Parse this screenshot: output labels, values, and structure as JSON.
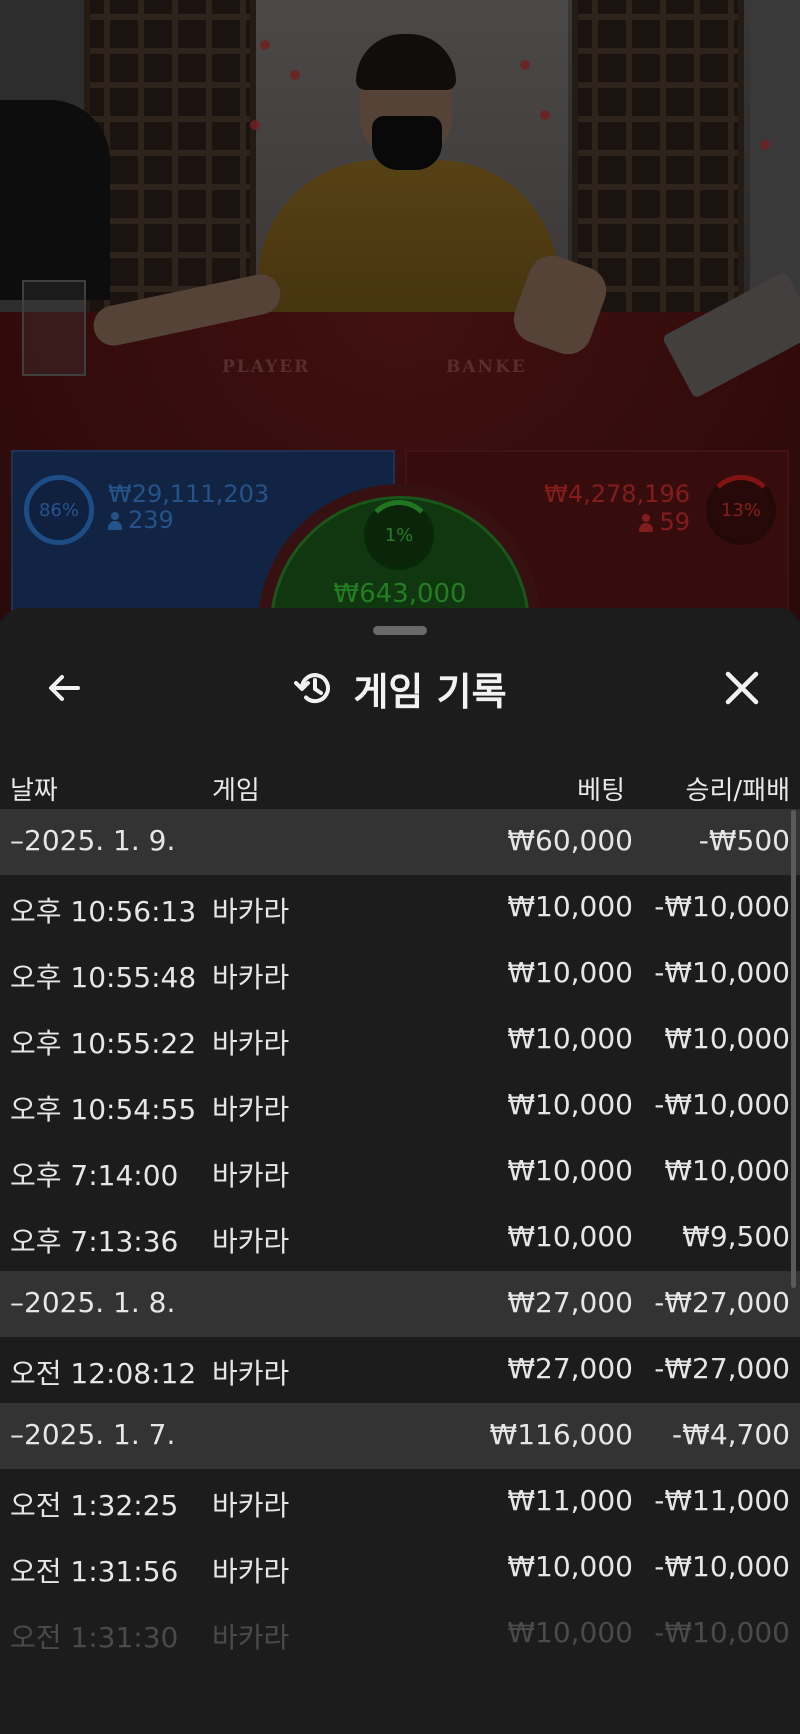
{
  "video": {
    "table_labels": {
      "player": "PLAYER",
      "banker": "BANKE"
    }
  },
  "board": {
    "player": {
      "percent": "86%",
      "amount": "₩29,111,203",
      "count": "239",
      "color": "#3c86dd"
    },
    "banker": {
      "percent": "13%",
      "amount": "₩4,278,196",
      "count": "59",
      "color": "#d43030"
    },
    "tie": {
      "percent": "1%",
      "amount": "₩643,000",
      "color": "#3ac83a"
    }
  },
  "sheet": {
    "title": "게임 기록",
    "icons": {
      "back": "arrow-left-icon",
      "history": "history-icon",
      "close": "close-icon"
    },
    "columns": {
      "date": "날짜",
      "game": "게임",
      "bet": "베팅",
      "win_loss": "승리/패배"
    },
    "groups": [
      {
        "date": "–2025. 1. 9.",
        "bet": "₩60,000",
        "win_loss": "-₩500",
        "rows": [
          {
            "time": "오후 10:56:13",
            "game": "바카라",
            "bet": "₩10,000",
            "win_loss": "-₩10,000"
          },
          {
            "time": "오후 10:55:48",
            "game": "바카라",
            "bet": "₩10,000",
            "win_loss": "-₩10,000"
          },
          {
            "time": "오후 10:55:22",
            "game": "바카라",
            "bet": "₩10,000",
            "win_loss": "₩10,000"
          },
          {
            "time": "오후 10:54:55",
            "game": "바카라",
            "bet": "₩10,000",
            "win_loss": "-₩10,000"
          },
          {
            "time": "오후 7:14:00",
            "game": "바카라",
            "bet": "₩10,000",
            "win_loss": "₩10,000"
          },
          {
            "time": "오후 7:13:36",
            "game": "바카라",
            "bet": "₩10,000",
            "win_loss": "₩9,500"
          }
        ]
      },
      {
        "date": "–2025. 1. 8.",
        "bet": "₩27,000",
        "win_loss": "-₩27,000",
        "rows": [
          {
            "time": "오전 12:08:12",
            "game": "바카라",
            "bet": "₩27,000",
            "win_loss": "-₩27,000"
          }
        ]
      },
      {
        "date": "–2025. 1. 7.",
        "bet": "₩116,000",
        "win_loss": "-₩4,700",
        "rows": [
          {
            "time": "오전 1:32:25",
            "game": "바카라",
            "bet": "₩11,000",
            "win_loss": "-₩11,000"
          },
          {
            "time": "오전 1:31:56",
            "game": "바카라",
            "bet": "₩10,000",
            "win_loss": "-₩10,000"
          },
          {
            "time": "오전 1:31:30",
            "game": "바카라",
            "bet": "₩10,000",
            "win_loss": "-₩10,000"
          }
        ]
      }
    ]
  }
}
